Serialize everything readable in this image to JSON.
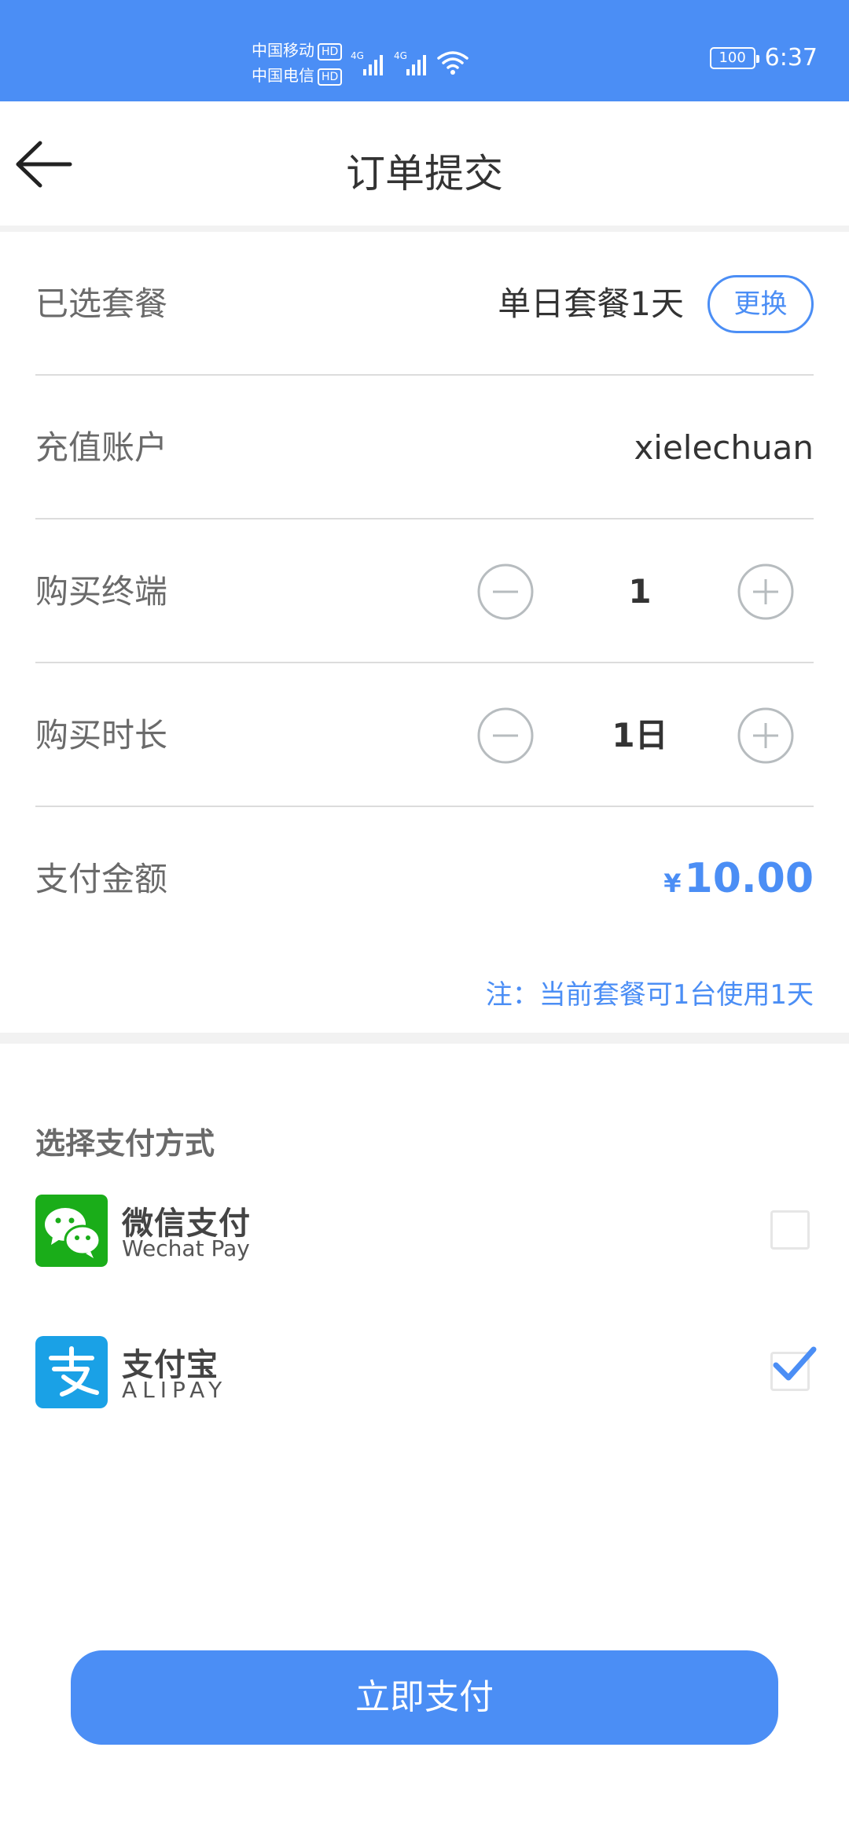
{
  "status_bar": {
    "carrier1": "中国移动",
    "carrier2": "中国电信",
    "hd": "HD",
    "network": "4G",
    "battery": "100",
    "time": "6:37",
    "color": "#4b8ef5"
  },
  "header": {
    "title": "订单提交",
    "back_icon": "arrow-left-icon"
  },
  "order": {
    "package_label": "已选套餐",
    "package_value": "单日套餐1天",
    "change_label": "更换",
    "account_label": "充值账户",
    "account_value": "xielechuan",
    "terminals_label": "购买终端",
    "terminals_value": "1",
    "duration_label": "购买时长",
    "duration_value": "1日",
    "amount_label": "支付金额",
    "currency": "¥",
    "amount_value": "10.00",
    "note": "注：当前套餐可1台使用1天"
  },
  "payment": {
    "heading": "选择支付方式",
    "options": [
      {
        "name": "微信支付",
        "sub": "Wechat Pay",
        "icon": "wechat-pay-icon",
        "checked": false,
        "color": "#1aad19"
      },
      {
        "name": "支付宝",
        "sub": "ALIPAY",
        "icon": "alipay-icon",
        "checked": true,
        "color": "#1aa1e6"
      }
    ]
  },
  "submit_label": "立即支付",
  "colors": {
    "accent": "#4b8ef5",
    "divider": "#dcdcdc",
    "label": "#6a6a6a"
  }
}
